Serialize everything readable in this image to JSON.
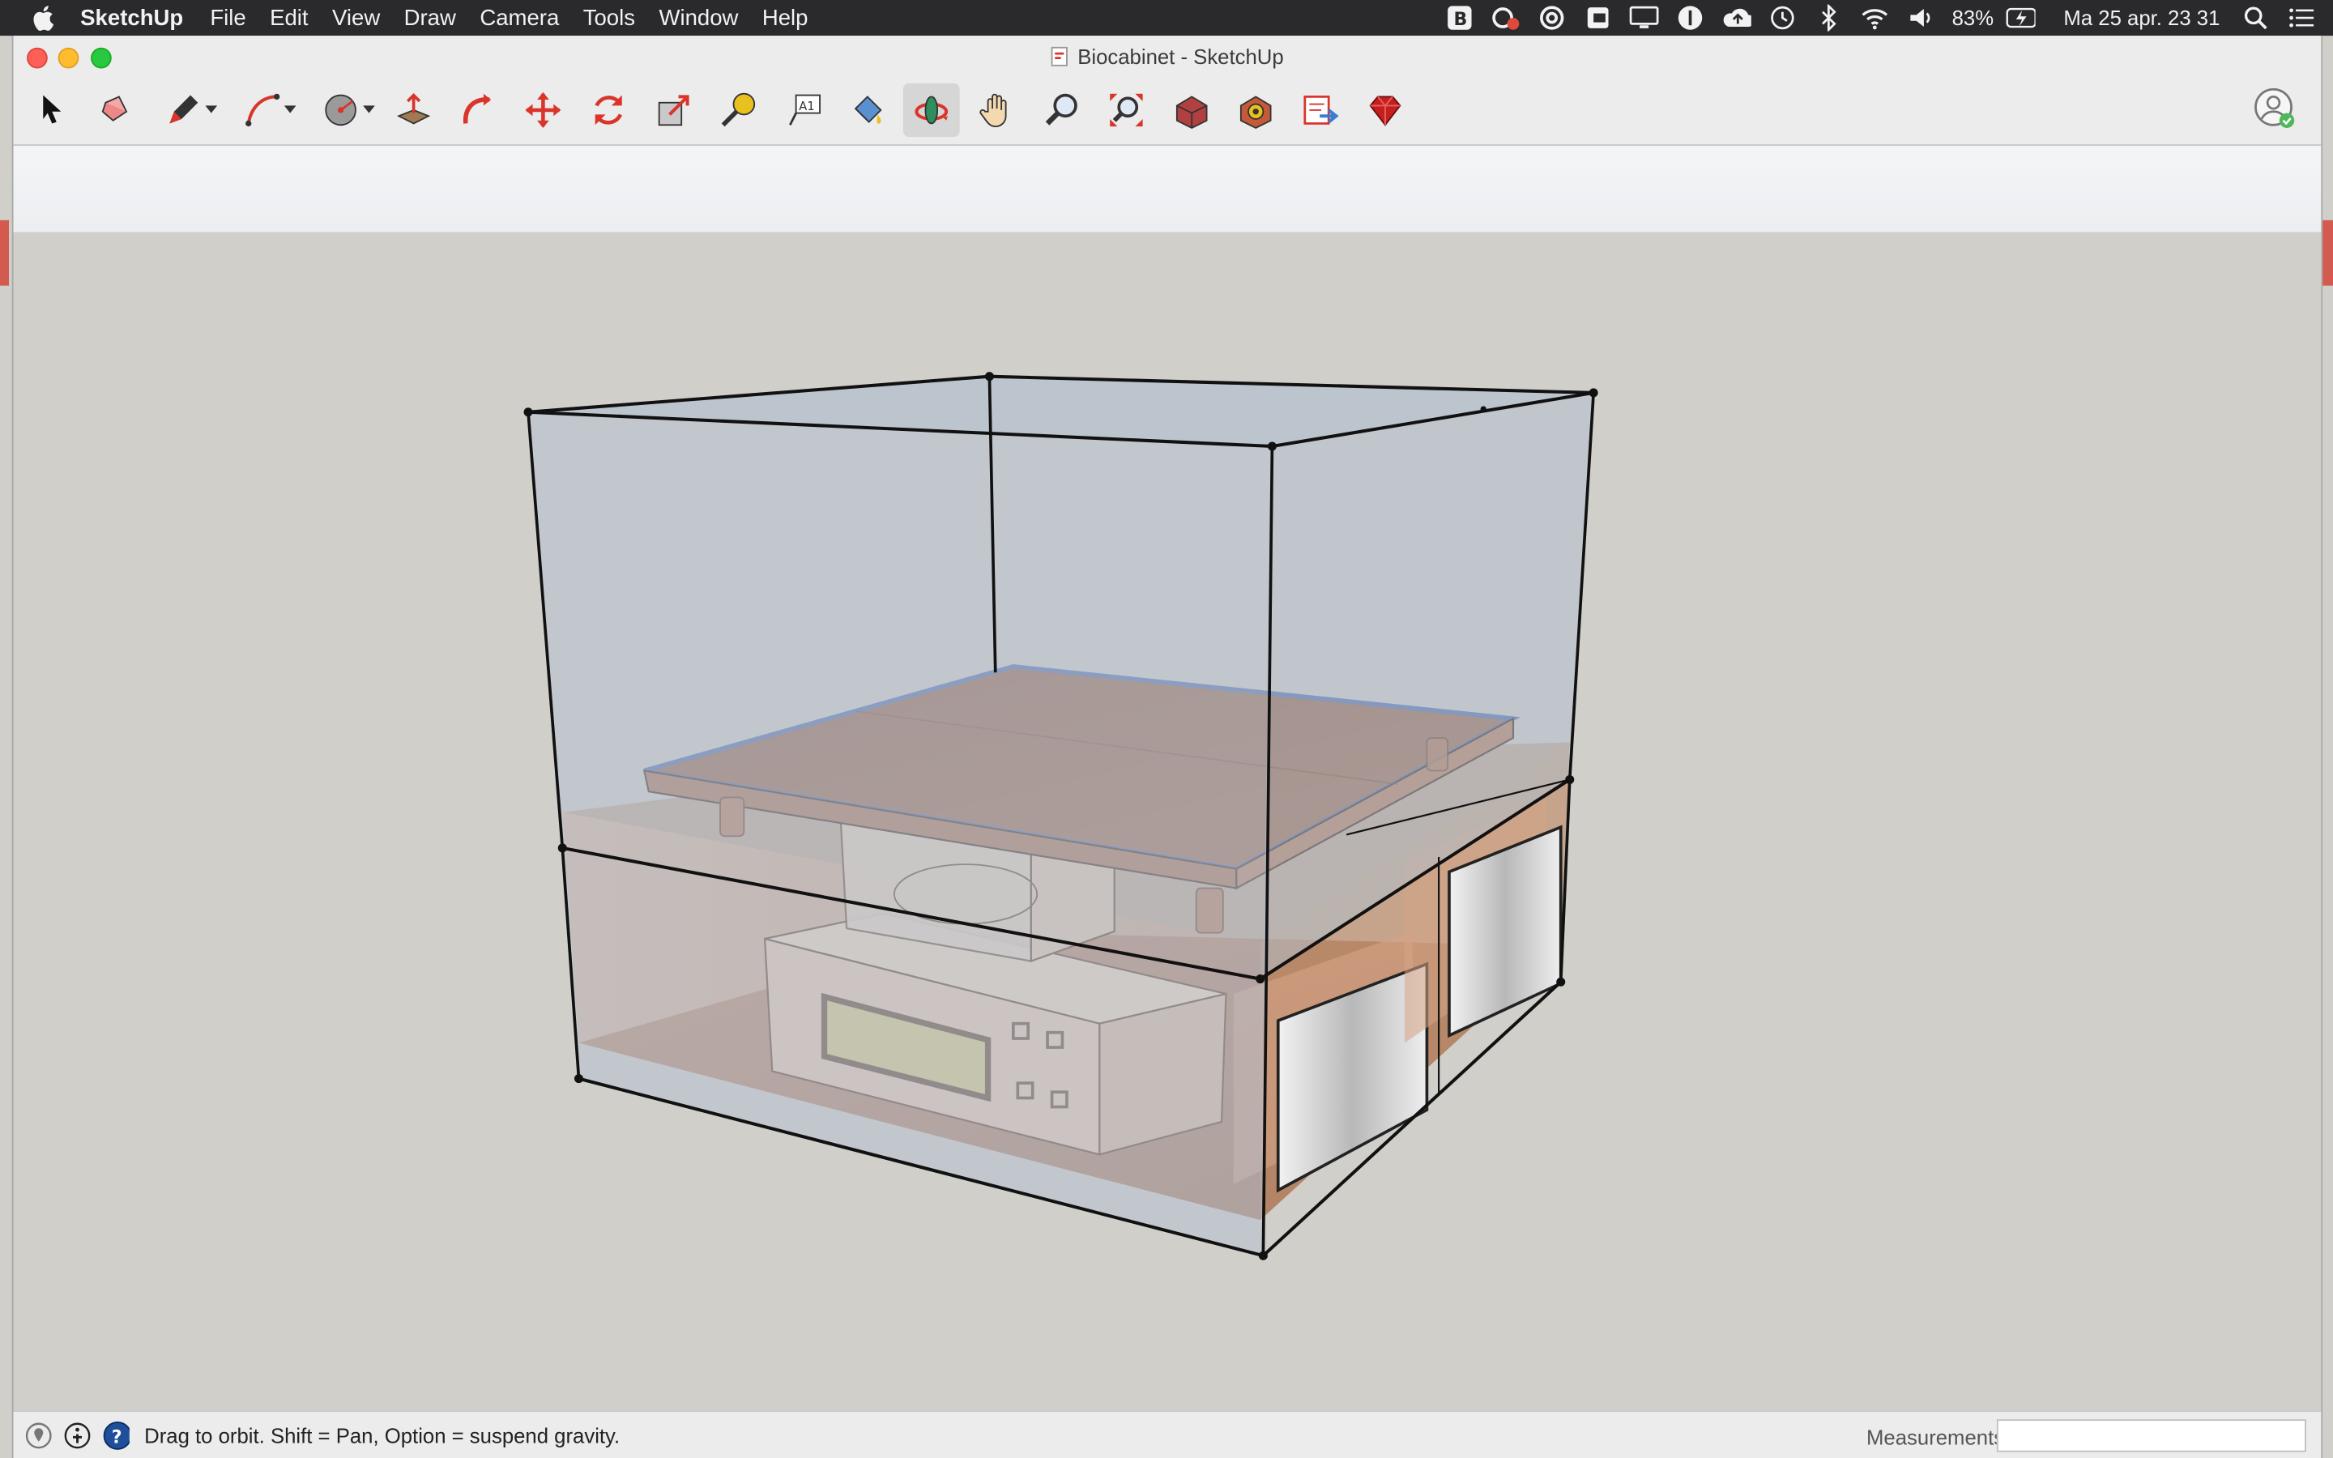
{
  "menubar": {
    "app_name": "SketchUp",
    "items": [
      "File",
      "Edit",
      "View",
      "Draw",
      "Camera",
      "Tools",
      "Window",
      "Help"
    ],
    "battery": "83%",
    "datetime": "Ma 25 apr.  23 31"
  },
  "window": {
    "title": "Biocabinet - SketchUp"
  },
  "toolbar": {
    "tools": [
      "select",
      "eraser",
      "line",
      "arc",
      "shapes",
      "push-pull",
      "offset",
      "move",
      "rotate",
      "scale",
      "tape-measure",
      "text",
      "paint-bucket",
      "orbit",
      "pan",
      "zoom",
      "zoom-extents",
      "3d-warehouse",
      "extension-warehouse",
      "send-to-layout",
      "ruby-console"
    ],
    "active_tool": "orbit"
  },
  "statusbar": {
    "message": "Drag to orbit. Shift = Pan, Option = suspend gravity.",
    "measurements_label": "Measurements",
    "measurements_value": ""
  },
  "colors": {
    "viewport_bg": "#d0cfca",
    "glass": "#b7c2cf",
    "wood": "#c9936f",
    "accent_red": "#d9352b"
  }
}
